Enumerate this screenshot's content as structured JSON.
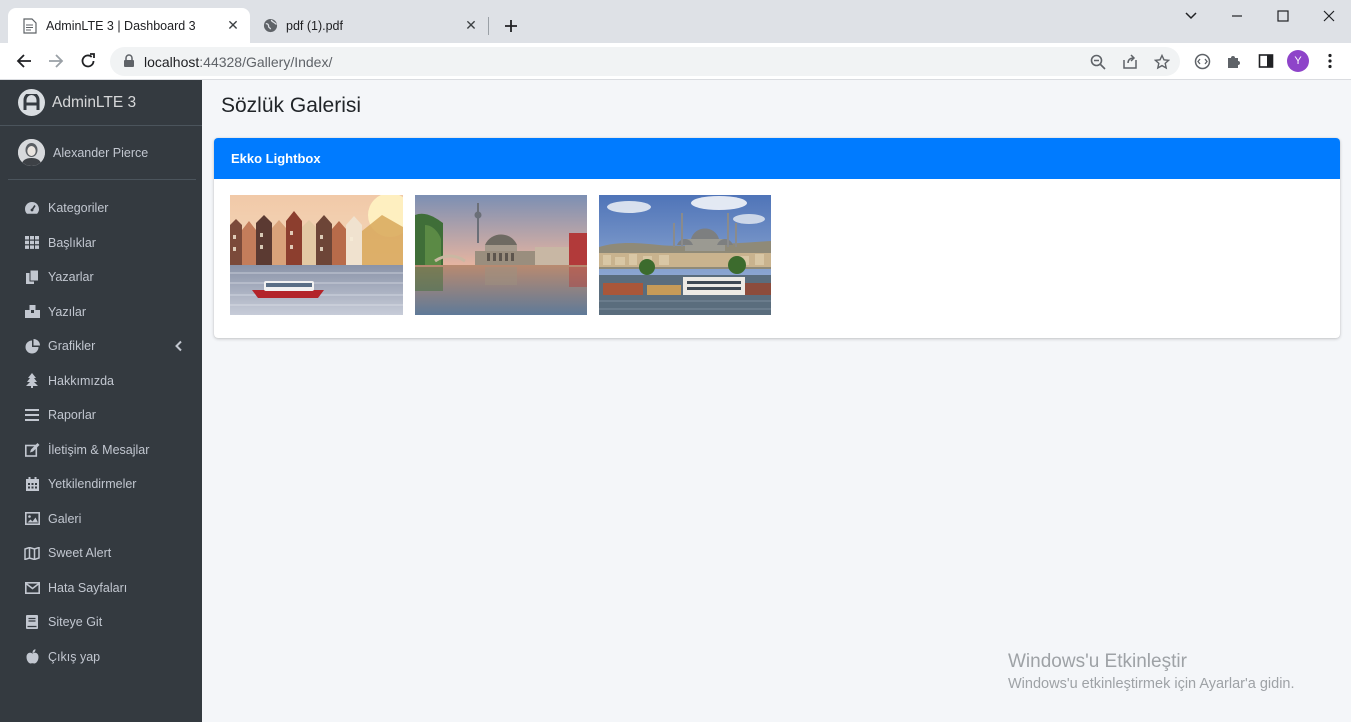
{
  "browser": {
    "tabs": [
      {
        "title": "AdminLTE 3 | Dashboard 3",
        "active": true
      },
      {
        "title": "pdf (1).pdf",
        "active": false
      }
    ],
    "url": {
      "host": "localhost",
      "path": ":44328/Gallery/Index/"
    },
    "profile_initial": "Y"
  },
  "sidebar": {
    "brand": "AdminLTE 3",
    "user": "Alexander Pierce",
    "items": [
      {
        "label": "Kategoriler",
        "icon": "tachometer-icon"
      },
      {
        "label": "Başlıklar",
        "icon": "grid-icon"
      },
      {
        "label": "Yazarlar",
        "icon": "copy-icon"
      },
      {
        "label": "Yazılar",
        "icon": "box-icon"
      },
      {
        "label": "Grafikler",
        "icon": "pie-chart-icon",
        "has_submenu": true
      },
      {
        "label": "Hakkımızda",
        "icon": "tree-icon"
      },
      {
        "label": "Raporlar",
        "icon": "bars-icon"
      },
      {
        "label": "İletişim & Mesajlar",
        "icon": "edit-icon"
      },
      {
        "label": "Yetkilendirmeler",
        "icon": "calendar-icon"
      },
      {
        "label": "Galeri",
        "icon": "image-icon"
      },
      {
        "label": "Sweet Alert",
        "icon": "map-icon"
      },
      {
        "label": "Hata Sayfaları",
        "icon": "envelope-icon"
      },
      {
        "label": "Siteye Git",
        "icon": "book-icon"
      },
      {
        "label": "Çıkış yap",
        "icon": "apple-icon"
      }
    ]
  },
  "content": {
    "page_title": "Sözlük Galerisi",
    "card_title": "Ekko Lightbox",
    "gallery": [
      {
        "subject": "amsterdam-canal-photo"
      },
      {
        "subject": "berlin-museum-island-photo"
      },
      {
        "subject": "istanbul-mosque-photo"
      }
    ]
  },
  "os_watermark": {
    "line1": "Windows'u Etkinleştir",
    "line2": "Windows'u etkinleştirmek için Ayarlar'a gidin."
  },
  "colors": {
    "sidebar_bg": "#343a40",
    "primary": "#007bff",
    "content_bg": "#f4f6f9"
  }
}
